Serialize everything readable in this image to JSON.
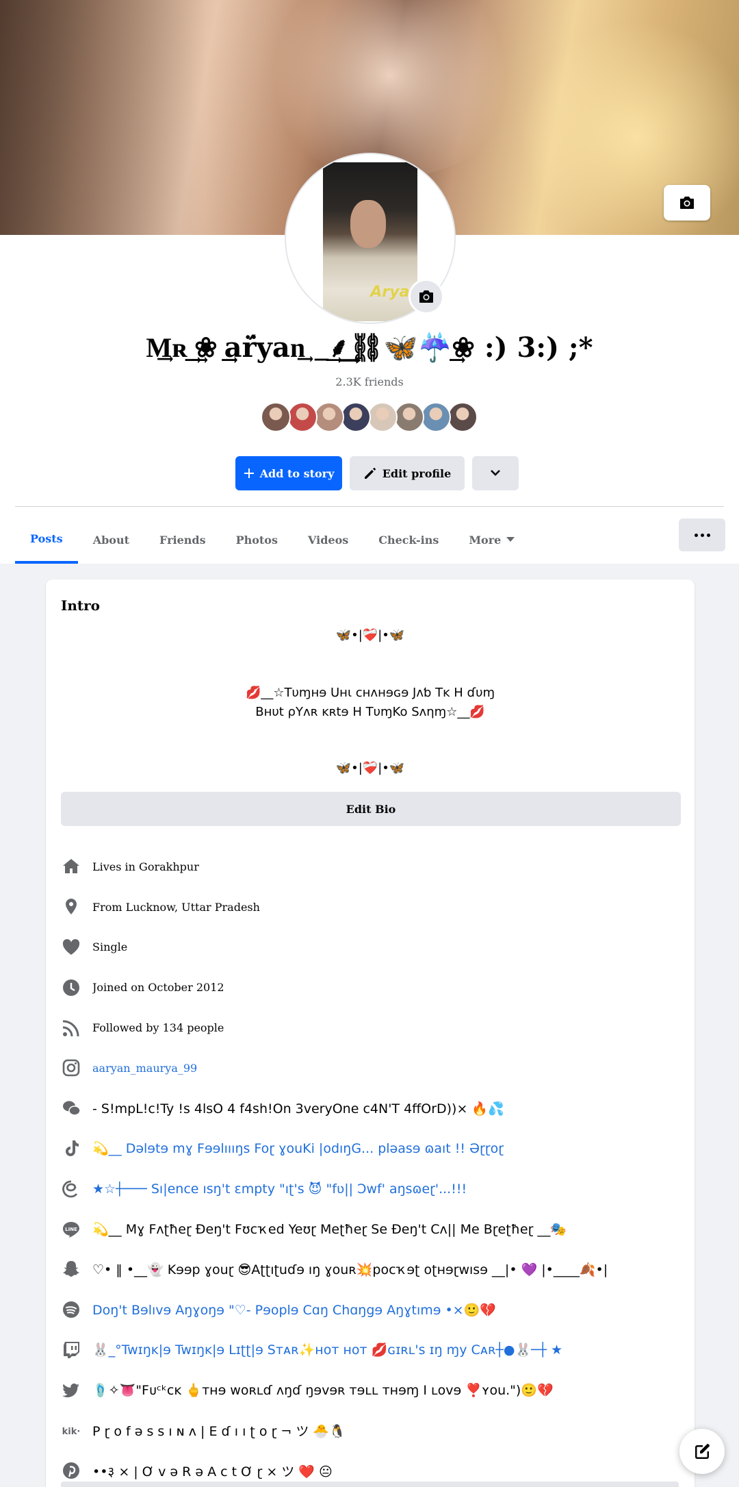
{
  "profile": {
    "name": "M͢ʀ͢͢ ͢❀ ͢͢ar̈́yan͢ _͢⸙͢⛓🦋☔͢͢❀ :) 3:) ;*",
    "friends_count": "2.3K friends",
    "friend_avatars": [
      "#7a5a4e",
      "#c44a4a",
      "#b58d7c",
      "#3b3f5c",
      "#d6c7b8",
      "#8a7b70",
      "#6a8fb3",
      "#5a4a48"
    ]
  },
  "actions": {
    "add_story": "Add to story",
    "edit_profile": "Edit profile"
  },
  "tabs": [
    {
      "label": "Posts"
    },
    {
      "label": "About"
    },
    {
      "label": "Friends"
    },
    {
      "label": "Photos"
    },
    {
      "label": "Videos"
    },
    {
      "label": "Check-ins"
    },
    {
      "label": "More"
    }
  ],
  "intro": {
    "title": "Intro",
    "bio_line1": "🦋•|❤️‍🩹|•🦋",
    "bio_line2": "💋__☆Tυɱнɘ Uнι ᴄнᴧнɘɢɘ Jᴧƅ Tᴋ H ɗυɱ",
    "bio_line3": "Bнυt ρYᴧʀ ᴋʀtɘ H TυɱKo Sᴧηɱ☆__💋",
    "bio_line4": "🦋•|❤️‍🩹|•🦋",
    "edit_bio": "Edit Bio",
    "items": [
      {
        "icon": "home-icon",
        "text": "Lives in Gorakhpur"
      },
      {
        "icon": "location-pin-icon",
        "text": "From Lucknow, Uttar Pradesh"
      },
      {
        "icon": "heart-icon",
        "text": "Single"
      },
      {
        "icon": "clock-icon",
        "text": "Joined on October 2012"
      },
      {
        "icon": "rss-icon",
        "text": "Followed by 134 people"
      },
      {
        "icon": "instagram-icon",
        "text": "aaryan_maurya_99"
      },
      {
        "icon": "wechat-icon",
        "text": "- S!mpL!c!Ty !s 4lsO 4 f4sh!On 3veryOne c4N'T 4ffOrD))× 🔥💦"
      },
      {
        "icon": "tiktok-icon",
        "text": "💫__ Dəlɘtɘ mɣ Fɘɘlıııŋs Foɽ ɣouKi |odıŋG... pləasɘ ɷaıt !! Əɽɽoɽ"
      },
      {
        "icon": "threads-icon",
        "text": "★☆┼─── Sı|ence ısŋ't ɛmpty \"ıʈ's 😈 \"fʋ|| Ɔwf' aŋsɷeɽ'...!!!"
      },
      {
        "icon": "line-icon",
        "text": "💫__ Mɣ Fʌʈħeɽ Ɖeŋ't Fʊcҡed Yeʊɽ Meʈħeɽ Se Ɖeŋ't Cʌ|| Me Bɽeʈħeɽ __🎭"
      },
      {
        "icon": "snapchat-icon",
        "text": "♡• ‖ •__👻 Kɘɘp ɣouɽ 😎Aʈʈıʈuɗɘ ıŋ ɣouʀ💥pocҡɘʈ oʈʜɘɽwısɘ __|• 💜 |•____🍂•|"
      },
      {
        "icon": "spotify-icon",
        "text": "Doŋ't Bɘlıvɘ Aŋɣoŋɘ \"♡- Pɘoplɘ Cɑŋ Chɑŋgɘ Aŋɣtımɘ •×🙂💔"
      },
      {
        "icon": "twitch-icon",
        "text": "🐰_°Twɪŋĸ|ɘ Twɪŋĸ|ɘ Lɪʈʈ|ɘ Sтᴀʀ✨нoт нoт 💋ɢɪʀʟ's ɪŋ ɱy Cᴀʀ┼●🐰─┼ ★"
      },
      {
        "icon": "twitter-icon",
        "text": "🩴✧👅\"Fᴜᶜᵏᴄᴋ 🖕ᴛнɘ ᴡoʀʟɗ ᴧŋɗ ŋɘᴠɘʀ тɘʟʟ тнɘɱ I ʟoᴠɘ ❣️ʏou.\")🙂💔"
      },
      {
        "icon": "kik-icon",
        "text": "P ɽ o f ə s s ı ɴ ʌ | E ɗ ı ı ʈ o ɽ ¬ ツ 🐣🐧"
      },
      {
        "icon": "pinterest-icon",
        "text": "••३ × | Ơ v ə R ə A c t Ơ ɽ × ツ ❤️ 😐"
      }
    ]
  },
  "colors": {
    "accent": "#0866ff",
    "link": "#216fdb",
    "secondary_text": "#65676b",
    "button_grey": "#e4e6eb"
  }
}
